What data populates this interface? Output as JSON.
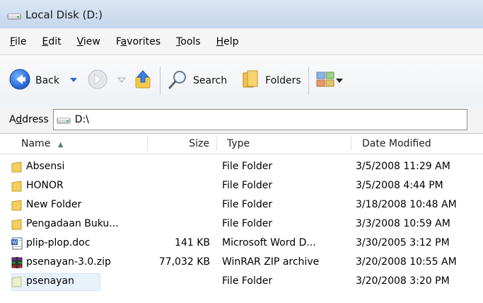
{
  "window": {
    "title": "Local Disk (D:)"
  },
  "menu": {
    "items": [
      {
        "first": "F",
        "rest": "ile"
      },
      {
        "first": "E",
        "rest": "dit"
      },
      {
        "first": "V",
        "rest": "iew"
      },
      {
        "pre": "F",
        "first": "a",
        "rest": "vorites"
      },
      {
        "first": "T",
        "rest": "ools"
      },
      {
        "first": "H",
        "rest": "elp"
      }
    ]
  },
  "toolbar": {
    "back_label": "Back",
    "search_label": "Search",
    "folders_label": "Folders"
  },
  "address": {
    "pre": "A",
    "first": "d",
    "rest": "dress",
    "value": "D:\\"
  },
  "columns": {
    "name": "Name",
    "sort_arrow": "▲",
    "size": "Size",
    "type": "Type",
    "date": "Date Modified"
  },
  "files": [
    {
      "name": "Absensi",
      "size": "",
      "type": "File Folder",
      "date": "3/5/2008 11:29 AM",
      "icon": "folder-icon"
    },
    {
      "name": "HONOR",
      "size": "",
      "type": "File Folder",
      "date": "3/5/2008 4:44 PM",
      "icon": "folder-icon"
    },
    {
      "name": "New Folder",
      "size": "",
      "type": "File Folder",
      "date": "3/18/2008 10:48 AM",
      "icon": "folder-icon"
    },
    {
      "name": "Pengadaan Buku...",
      "size": "",
      "type": "File Folder",
      "date": "3/3/2008 10:59 AM",
      "icon": "folder-icon"
    },
    {
      "name": "plip-plop.doc",
      "size": "141 KB",
      "type": "Microsoft Word D...",
      "date": "3/30/2005 3:12 PM",
      "icon": "word-doc-icon"
    },
    {
      "name": "psenayan-3.0.zip",
      "size": "77,032 KB",
      "type": "WinRAR ZIP archive",
      "date": "3/20/2008 10:55 AM",
      "icon": "winrar-archive-icon"
    },
    {
      "name": "psenayan",
      "size": "",
      "type": "File Folder",
      "date": "3/20/2008 3:20 PM",
      "icon": "folder-icon",
      "selected": true
    }
  ]
}
